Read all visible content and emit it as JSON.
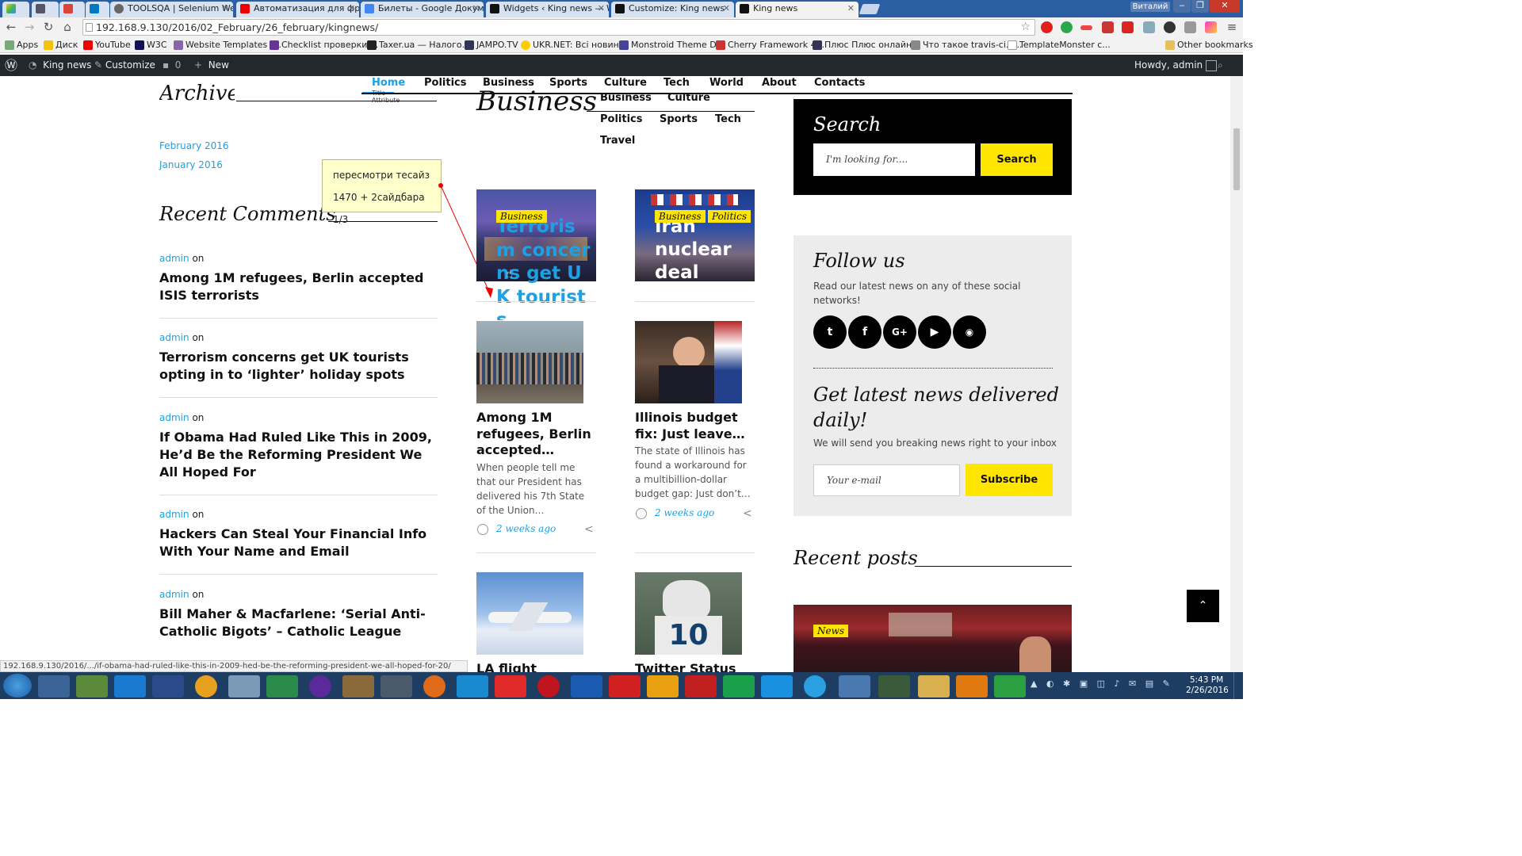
{
  "browser": {
    "tabs": [
      {
        "label": ""
      },
      {
        "label": ""
      },
      {
        "label": ""
      },
      {
        "label": ""
      },
      {
        "label": "TOOLSQA | Selenium Web"
      },
      {
        "label": "Автоматизация для фрон"
      },
      {
        "label": "Билеты - Google Докуме"
      },
      {
        "label": "Widgets ‹ King news — W"
      },
      {
        "label": "Customize: King news"
      },
      {
        "label": "King news"
      }
    ],
    "user_label": "Виталий",
    "url": "192.168.9.130/2016/02_February/26_february/kingnews/",
    "bookmarks": [
      "Apps",
      "Диск",
      "YouTube",
      "W3C",
      "Website Templates |...",
      "Checklist проверки ...",
      "Taxer.ua — Налого...",
      "JAMPO.TV",
      "UKR.NET: Всі новин...",
      "Monstroid Theme D...",
      "Cherry Framework 4...",
      "Плюс Плюс онлайн...",
      "Что такое travis-ci.o...",
      "TemplateMonster c..."
    ],
    "other_bookmarks": "Other bookmarks",
    "status_url": "192.168.9.130/2016/.../if-obama-had-ruled-like-this-in-2009-hed-be-the-reforming-president-we-all-hoped-for-20/"
  },
  "wp_admin": {
    "site": "King news",
    "customize": "Customize",
    "comments": "0",
    "new": "New",
    "howdy": "Howdy, admin"
  },
  "menu": {
    "items": [
      "Home",
      "Politics",
      "Business",
      "Sports",
      "Culture",
      "Tech",
      "World",
      "About",
      "Contacts"
    ],
    "home_tooltip_1": "Title",
    "home_tooltip_2": "Attribute"
  },
  "left": {
    "archive_heading": "Archive",
    "archives": [
      "February 2016",
      "January 2016"
    ],
    "recent_comments_heading": "Recent Comments",
    "comments": [
      {
        "author": "admin",
        "on": "on",
        "title": "Among 1M refugees, Berlin accepted ISIS terrorists"
      },
      {
        "author": "admin",
        "on": "on",
        "title": "Terrorism concerns get UK tourists opting in to ‘lighter’ holiday spots"
      },
      {
        "author": "admin",
        "on": "on",
        "title": "If Obama Had Ruled Like This in 2009, He’d Be the Reforming President We All Hoped For"
      },
      {
        "author": "admin",
        "on": "on",
        "title": "Hackers Can Steal Your Financial Info With Your Name and Email"
      },
      {
        "author": "admin",
        "on": "on",
        "title": "Bill Maher & Macfarlene: ‘Serial Anti-Catholic Bigots’ – Catholic League"
      }
    ]
  },
  "note": {
    "line1": "пересмотри тесайз",
    "line2": "1470 + 2сайдбара 1/3"
  },
  "center": {
    "heading": "Business",
    "categories": [
      "Business",
      "Culture",
      "Politics",
      "Sports",
      "Tech",
      "Travel"
    ],
    "featured": [
      {
        "badges": [
          "Business"
        ],
        "overlay_title": "Terrorism concerns get UK tourists"
      },
      {
        "badges": [
          "Business",
          "Politics"
        ],
        "overlay_title": "Iran nuclear deal"
      }
    ],
    "posts": [
      {
        "title": "Among 1M refugees, Berlin accepted…",
        "excerpt": "When people tell me that our President has delivered his 7th State of the Union…",
        "date": "2 weeks ago"
      },
      {
        "title": "Illinois budget fix: Just leave…",
        "excerpt": "The state of Illinois has found a workaround for a multibillion-dollar budget gap: Just don’t…",
        "date": "2 weeks ago"
      }
    ],
    "bottom_titles": [
      "LA flight",
      "Twitter Status"
    ]
  },
  "sidebar": {
    "search_heading": "Search",
    "search_placeholder": "I'm looking for....",
    "search_button": "Search",
    "follow_heading": "Follow us",
    "follow_text": "Read our latest news on any of these social networks!",
    "socials": [
      "twitter-icon",
      "facebook-icon",
      "google-plus-icon",
      "youtube-icon",
      "rss-icon"
    ],
    "newsletter_heading": "Get latest news delivered daily!",
    "newsletter_text": "We will send you breaking news right to your inbox",
    "email_placeholder": "Your e-mail",
    "subscribe_button": "Subscribe",
    "recent_posts_heading": "Recent posts",
    "recent_badge": "News"
  },
  "taskbar": {
    "time": "5:43 PM",
    "date": "2/26/2016"
  },
  "colors": {
    "accent_blue": "#1da1e2",
    "accent_yellow": "#ffe500",
    "admin_bar": "#23282d"
  }
}
